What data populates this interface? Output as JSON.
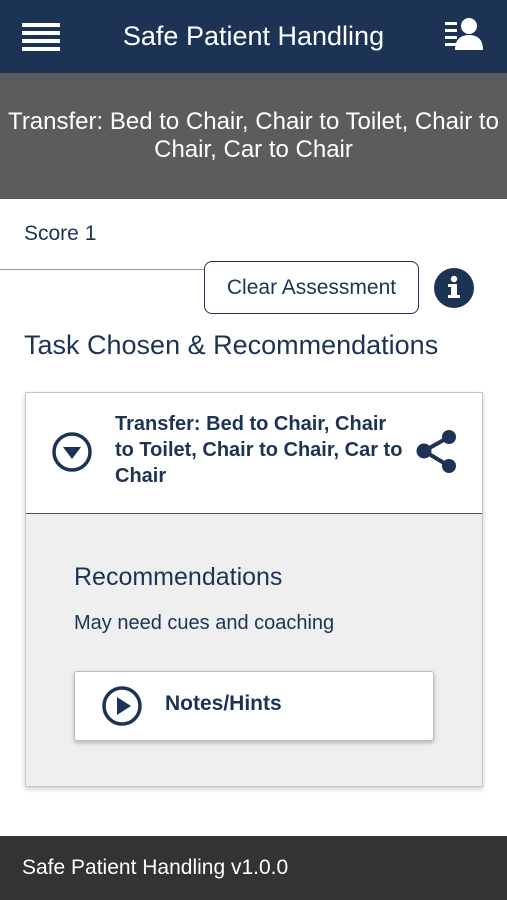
{
  "header": {
    "title": "Safe Patient Handling",
    "menu_icon": "hamburger-menu-icon",
    "profile_icon": "user-list-icon"
  },
  "task_banner": {
    "text": "Transfer: Bed to Chair, Chair to Toilet, Chair to Chair, Car to Chair"
  },
  "assessment": {
    "score_label": "Score 1",
    "clear_button_label": "Clear Assessment",
    "info_icon": "info-icon"
  },
  "section": {
    "heading": "Task Chosen & Recommendations"
  },
  "task_card": {
    "task_title": "Transfer: Bed to Chair, Chair to Toilet, Chair to Chair, Car to Chair",
    "expand_icon": "chevron-down-circle-icon",
    "share_icon": "share-icon",
    "recommendations_heading": "Recommendations",
    "recommendation_text": "May need cues and coaching",
    "notes_button_label": "Notes/Hints",
    "notes_icon": "play-circle-icon"
  },
  "footer": {
    "text": "Safe Patient Handling v1.0.0"
  },
  "colors": {
    "navy": "#1c3355",
    "banner_gray": "#5c5c5c",
    "footer_dark": "#333333",
    "card_background": "#efefef"
  }
}
